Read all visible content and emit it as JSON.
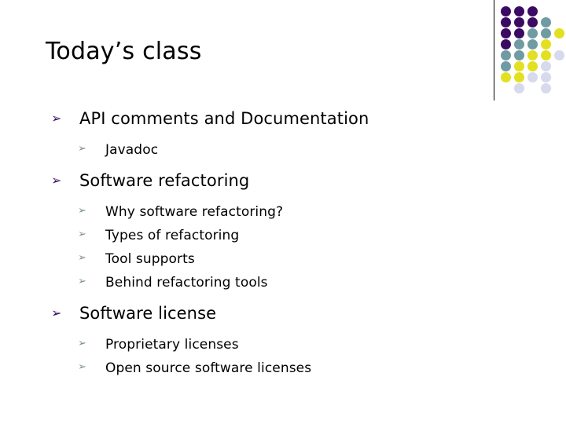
{
  "slide": {
    "title": "Today’s class",
    "markers": {
      "level1_glyph": "➢",
      "level2_glyph": "➢",
      "level1_color": "#3b0a62",
      "level2_color": "#7d8f96"
    },
    "outline": [
      {
        "level": 1,
        "text": "API comments and Documentation",
        "children": [
          {
            "level": 2,
            "text": "Javadoc"
          }
        ]
      },
      {
        "level": 1,
        "text": "Software refactoring",
        "children": [
          {
            "level": 2,
            "text": "Why software refactoring?"
          },
          {
            "level": 2,
            "text": "Types of refactoring"
          },
          {
            "level": 2,
            "text": "Tool supports"
          },
          {
            "level": 2,
            "text": "Behind refactoring tools"
          }
        ]
      },
      {
        "level": 1,
        "text": "Software license",
        "children": [
          {
            "level": 2,
            "text": "Proprietary licenses"
          },
          {
            "level": 2,
            "text": "Open source software licenses"
          }
        ]
      }
    ]
  },
  "decoration": {
    "name": "dot-grid-graphic",
    "rule_color": "#000000",
    "palette": {
      "purple": "#3b0a62",
      "teal": "#6f9ba3",
      "yellow": "#e3e021",
      "lavender": "#d7d9ed"
    },
    "dot_size": 13,
    "col_step": 17,
    "row_step": 14,
    "rows": [
      [
        "purple",
        "purple",
        "purple",
        null,
        null
      ],
      [
        "purple",
        "purple",
        "purple",
        "teal",
        null
      ],
      [
        "purple",
        "purple",
        "teal",
        "teal",
        "yellow"
      ],
      [
        "purple",
        "teal",
        "teal",
        "yellow",
        null
      ],
      [
        "teal",
        "teal",
        "yellow",
        "yellow",
        "lavender"
      ],
      [
        "teal",
        "yellow",
        "yellow",
        "lavender",
        null
      ],
      [
        "yellow",
        "yellow",
        "lavender",
        "lavender",
        null
      ],
      [
        null,
        "lavender",
        null,
        "lavender",
        null
      ]
    ]
  }
}
